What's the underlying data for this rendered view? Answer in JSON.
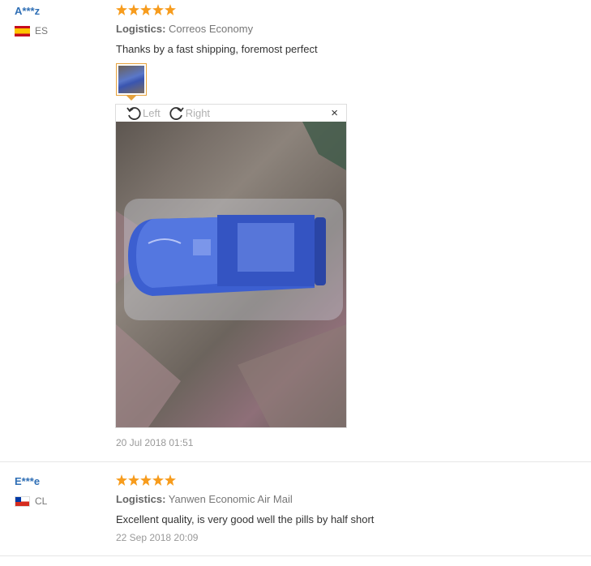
{
  "reviews": [
    {
      "user": "A***z",
      "country": "ES",
      "rating": 5,
      "logistics_label": "Logistics:",
      "logistics_value": "Correos Economy",
      "text": "Thanks by a fast shipping, foremost perfect",
      "viewer": {
        "rotate_left": "Left",
        "rotate_right": "Right",
        "close": "×"
      },
      "date": "20 Jul 2018 01:51"
    },
    {
      "user": "E***e",
      "country": "CL",
      "rating": 5,
      "logistics_label": "Logistics:",
      "logistics_value": "Yanwen Economic Air Mail",
      "text": "Excellent quality, is very good well the pills by half short",
      "date": "22 Sep 2018 20:09"
    }
  ],
  "colors": {
    "username": "#2f6fb5",
    "star": "#f79c1d",
    "thumb_border": "#e6a23c"
  }
}
